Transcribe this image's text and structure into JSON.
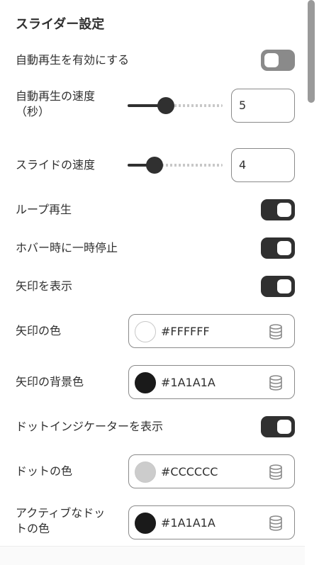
{
  "section": {
    "title": "スライダー設定"
  },
  "settings": {
    "autoplay": {
      "label": "自動再生を有効にする",
      "enabled": false
    },
    "autoplay_speed": {
      "label_line1": "自動再生の速度",
      "label_line2": "（秒）",
      "value": "5",
      "fill_fraction": 0.4
    },
    "slide_speed": {
      "label": "スライドの速度",
      "value": "4",
      "fill_fraction": 0.28
    },
    "loop": {
      "label": "ループ再生",
      "enabled": true
    },
    "pause_on_hover": {
      "label": "ホバー時に一時停止",
      "enabled": true
    },
    "show_arrows": {
      "label": "矢印を表示",
      "enabled": true
    },
    "arrow_color": {
      "label": "矢印の色",
      "hex": "#FFFFFF",
      "color": "#FFFFFF"
    },
    "arrow_bg_color": {
      "label": "矢印の背景色",
      "hex": "#1A1A1A",
      "color": "#1A1A1A"
    },
    "show_dots": {
      "label": "ドットインジケーターを表示",
      "enabled": true
    },
    "dot_color": {
      "label": "ドットの色",
      "hex": "#CCCCCC",
      "color": "#CCCCCC"
    },
    "active_dot_color": {
      "label_line1": "アクティブなドッ",
      "label_line2": "トの色",
      "hex": "#1A1A1A",
      "color": "#1A1A1A"
    }
  },
  "icons": {
    "dynamic_source": "database-icon"
  }
}
